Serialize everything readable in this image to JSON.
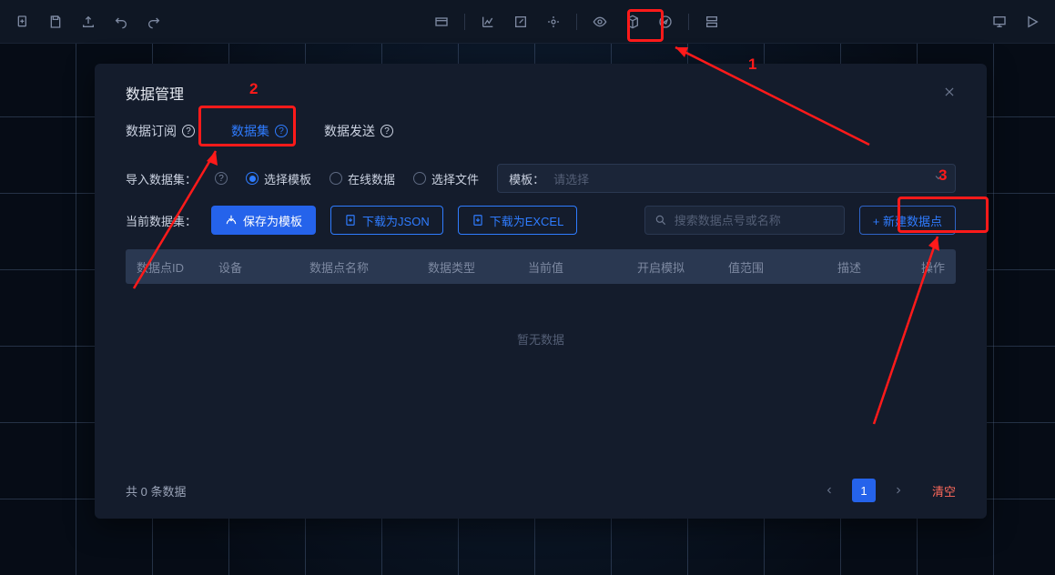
{
  "dialog": {
    "title": "数据管理"
  },
  "tabs": {
    "subscribe": "数据订阅",
    "dataset": "数据集",
    "send": "数据发送"
  },
  "importRow": {
    "label": "导入数据集：",
    "opt_template": "选择模板",
    "opt_online": "在线数据",
    "opt_file": "选择文件",
    "select_label": "模板：",
    "select_placeholder": "请选择"
  },
  "currentRow": {
    "label": "当前数据集：",
    "save_template": "保存为模板",
    "download_json": "下载为JSON",
    "download_excel": "下载为EXCEL",
    "search_placeholder": "搜索数据点号或名称",
    "add": "+ 新建数据点"
  },
  "columns": {
    "c0": "数据点ID",
    "c1": "设备",
    "c2": "数据点名称",
    "c3": "数据类型",
    "c4": "当前值",
    "c5": "开启模拟",
    "c6": "值范围",
    "c7": "描述",
    "c8": "操作"
  },
  "empty": "暂无数据",
  "footer": {
    "count": "共 0 条数据",
    "page": "1",
    "clear": "清空"
  },
  "annotations": {
    "n1": "1",
    "n2": "2",
    "n3": "3"
  }
}
